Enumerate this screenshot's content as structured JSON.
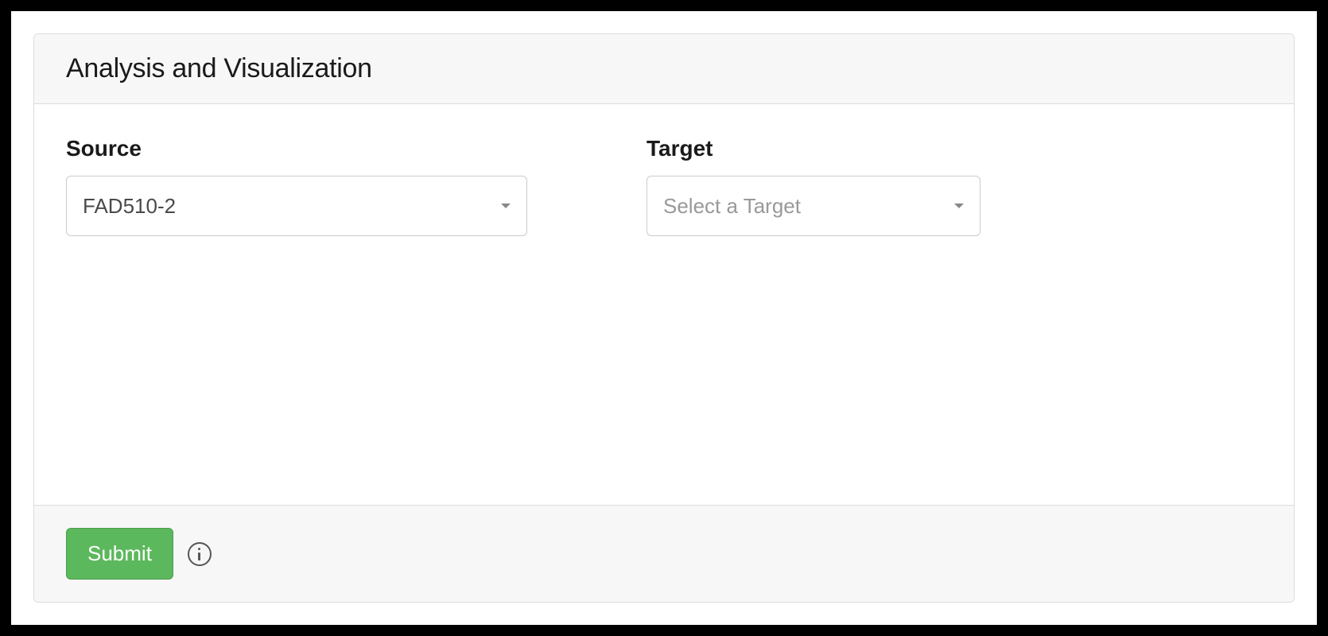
{
  "panel": {
    "title": "Analysis and Visualization"
  },
  "form": {
    "source": {
      "label": "Source",
      "value": "FAD510-2"
    },
    "target": {
      "label": "Target",
      "placeholder": "Select a Target"
    },
    "submit_label": "Submit"
  }
}
